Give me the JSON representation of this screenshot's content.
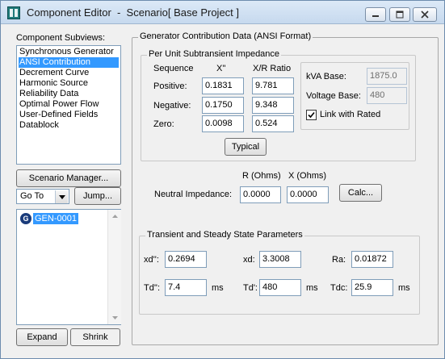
{
  "window": {
    "title": "Component Editor  -  Scenario[ Base Project ]",
    "minimize_icon": "minimize-icon",
    "maximize_icon": "maximize-icon",
    "close_icon": "close-icon"
  },
  "sidebar": {
    "subviews_label": "Component Subviews:",
    "subviews": [
      {
        "label": "Synchronous Generator",
        "selected": false
      },
      {
        "label": "ANSI Contribution",
        "selected": true
      },
      {
        "label": "Decrement Curve",
        "selected": false
      },
      {
        "label": "Harmonic Source",
        "selected": false
      },
      {
        "label": "Reliability Data",
        "selected": false
      },
      {
        "label": "Optimal Power Flow",
        "selected": false
      },
      {
        "label": "User-Defined Fields",
        "selected": false
      },
      {
        "label": "Datablock",
        "selected": false
      }
    ],
    "scenario_manager_label": "Scenario Manager...",
    "goto_value": "Go To",
    "jump_label": "Jump...",
    "tree_icon_letter": "G",
    "tree_item": "GEN-0001",
    "expand_label": "Expand",
    "shrink_label": "Shrink"
  },
  "main": {
    "group_title": "Generator Contribution Data (ANSI Format)",
    "impedance": {
      "title": "Per Unit Subtransient Impedance",
      "col_sequence": "Sequence",
      "col_x": "X''",
      "col_xr": "X/R Ratio",
      "rows": [
        {
          "label": "Positive:",
          "x": "0.1831",
          "xr": "9.781"
        },
        {
          "label": "Negative:",
          "x": "0.1750",
          "xr": "9.348"
        },
        {
          "label": "Zero:",
          "x": "0.0098",
          "xr": "0.524"
        }
      ],
      "kva_base_label": "kVA Base:",
      "kva_base_value": "1875.0",
      "voltage_base_label": "Voltage Base:",
      "voltage_base_value": "480",
      "link_rated_label": "Link with Rated",
      "link_rated_checked": true,
      "typical_label": "Typical"
    },
    "neutral": {
      "r_header": "R (Ohms)",
      "x_header": "X (Ohms)",
      "label": "Neutral Impedance:",
      "r_value": "0.0000",
      "x_value": "0.0000",
      "calc_label": "Calc..."
    },
    "transient": {
      "title": "Transient and Steady State Parameters",
      "xd_pp_label": "xd'':",
      "xd_pp_value": "0.2694",
      "xd_label": "xd:",
      "xd_value": "3.3008",
      "ra_label": "Ra:",
      "ra_value": "0.01872",
      "td_pp_label": "Td'':",
      "td_pp_value": "7.4",
      "td_pp_unit": "ms",
      "td_p_label": "Td':",
      "td_p_value": "480",
      "td_p_unit": "ms",
      "tdc_label": "Tdc:",
      "tdc_value": "25.9",
      "tdc_unit": "ms"
    }
  }
}
